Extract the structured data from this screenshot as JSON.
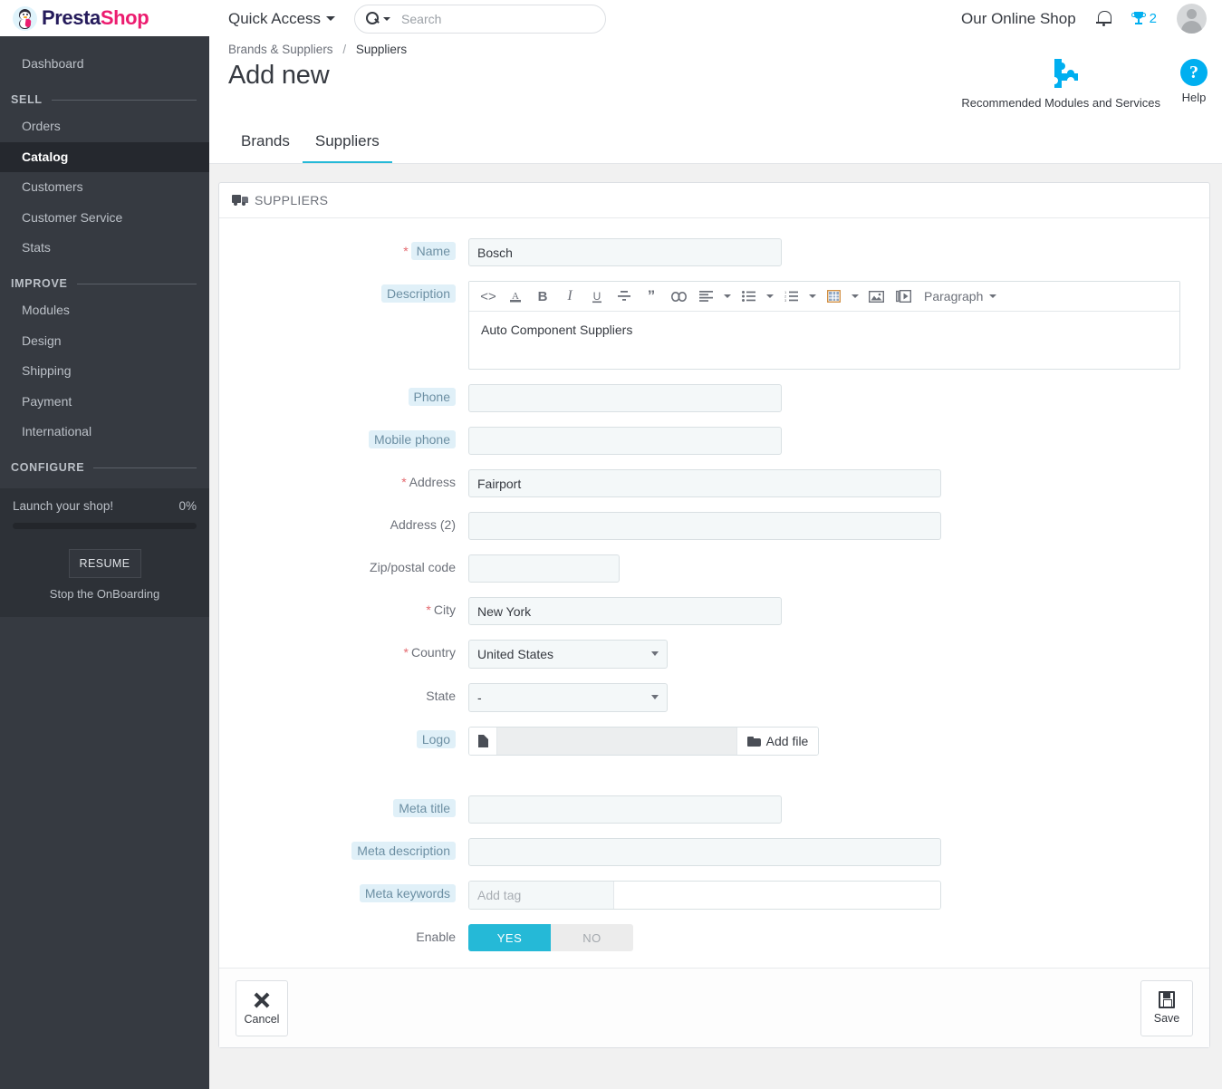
{
  "brand": {
    "name_part1": "Presta",
    "name_part2": "Shop"
  },
  "sidebar": {
    "dashboard": "Dashboard",
    "sections": [
      {
        "title": "SELL",
        "items": [
          "Orders",
          "Catalog",
          "Customers",
          "Customer Service",
          "Stats"
        ]
      },
      {
        "title": "IMPROVE",
        "items": [
          "Modules",
          "Design",
          "Shipping",
          "Payment",
          "International"
        ]
      },
      {
        "title": "CONFIGURE",
        "items": []
      }
    ],
    "active_item": "Catalog",
    "onboarding": {
      "label": "Launch your shop!",
      "percent": "0%",
      "resume_label": "RESUME",
      "stop_label": "Stop the OnBoarding"
    }
  },
  "header": {
    "quick_access": "Quick Access",
    "search_placeholder": "Search",
    "search_value": "",
    "shop_name": "Our Online Shop",
    "trophy_count": "2"
  },
  "page": {
    "breadcrumb_parent": "Brands & Suppliers",
    "breadcrumb_sep": "/",
    "breadcrumb_current": "Suppliers",
    "title": "Add new",
    "recommended_modules": "Recommended Modules and Services",
    "help": "Help",
    "tabs": [
      {
        "label": "Brands",
        "active": false
      },
      {
        "label": "Suppliers",
        "active": true
      }
    ]
  },
  "panel": {
    "title": "SUPPLIERS",
    "fields": {
      "name_label": "Name",
      "name_value": "Bosch",
      "description_label": "Description",
      "description_value": "Auto Component Suppliers",
      "phone_label": "Phone",
      "phone_value": "",
      "mobile_label": "Mobile phone",
      "mobile_value": "",
      "address_label": "Address",
      "address_value": "Fairport",
      "address2_label": "Address (2)",
      "address2_value": "",
      "zip_label": "Zip/postal code",
      "zip_value": "",
      "city_label": "City",
      "city_value": "New York",
      "country_label": "Country",
      "country_value": "United States",
      "state_label": "State",
      "state_value": "-",
      "logo_label": "Logo",
      "logo_value": "",
      "add_file_label": "Add file",
      "meta_title_label": "Meta title",
      "meta_title_value": "",
      "meta_description_label": "Meta description",
      "meta_description_value": "",
      "meta_keywords_label": "Meta keywords",
      "meta_keywords_placeholder": "Add tag",
      "enable_label": "Enable",
      "enable_yes": "YES",
      "enable_no": "NO",
      "enable_state": "YES"
    },
    "editor_toolbar": {
      "paragraph_label": "Paragraph",
      "buttons": [
        "source-code",
        "text-color",
        "bold",
        "italic",
        "underline",
        "strikethrough",
        "blockquote",
        "link",
        "align",
        "bullet-list",
        "numbered-list",
        "table",
        "image",
        "video"
      ]
    },
    "footer": {
      "cancel_label": "Cancel",
      "save_label": "Save"
    }
  },
  "colors": {
    "accent": "#25b9d7",
    "info": "#00aff0",
    "sidebar_bg": "#363a41",
    "required": "#e4696f",
    "label_highlight": "#e0f0f8"
  }
}
